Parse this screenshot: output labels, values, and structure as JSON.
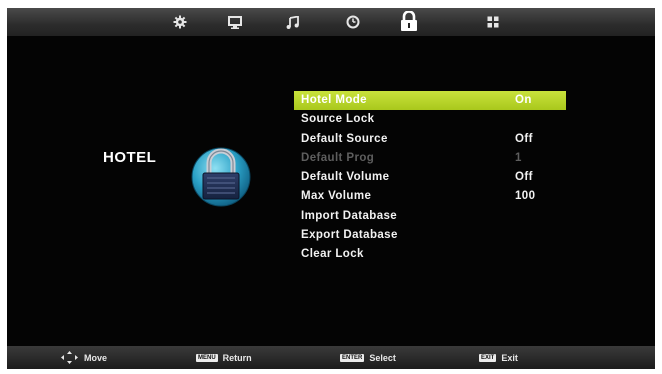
{
  "tabs": [
    {
      "id": "picture",
      "icon": "picture-settings-icon"
    },
    {
      "id": "channel",
      "icon": "monitor-icon"
    },
    {
      "id": "sound",
      "icon": "music-note-icon"
    },
    {
      "id": "time",
      "icon": "clock-icon"
    },
    {
      "id": "lock",
      "icon": "padlock-icon",
      "active": true
    },
    {
      "id": "setup",
      "icon": "grid-icon"
    }
  ],
  "section": {
    "title": "HOTEL",
    "icon": "padlock-badge-icon"
  },
  "menu": {
    "items": [
      {
        "label": "Hotel Mode",
        "value": "On",
        "selected": true
      },
      {
        "label": "Source Lock",
        "value": ""
      },
      {
        "label": "Default Source",
        "value": "Off"
      },
      {
        "label": "Default Prog",
        "value": "1",
        "disabled": true
      },
      {
        "label": "Default Volume",
        "value": "Off"
      },
      {
        "label": "Max Volume",
        "value": "100"
      },
      {
        "label": "Import Database",
        "value": ""
      },
      {
        "label": "Export Database",
        "value": ""
      },
      {
        "label": "Clear Lock",
        "value": ""
      }
    ]
  },
  "footer": {
    "move": {
      "icon": "dpad-arrows-icon",
      "label": "Move"
    },
    "return": {
      "key": "MENU",
      "label": "Return"
    },
    "select": {
      "key": "ENTER",
      "label": "Select"
    },
    "exit": {
      "key": "EXIT",
      "label": "Exit"
    }
  },
  "colors": {
    "selection": "#b5d22a",
    "background": "#040404",
    "disabled_text": "#5e5e5e"
  }
}
